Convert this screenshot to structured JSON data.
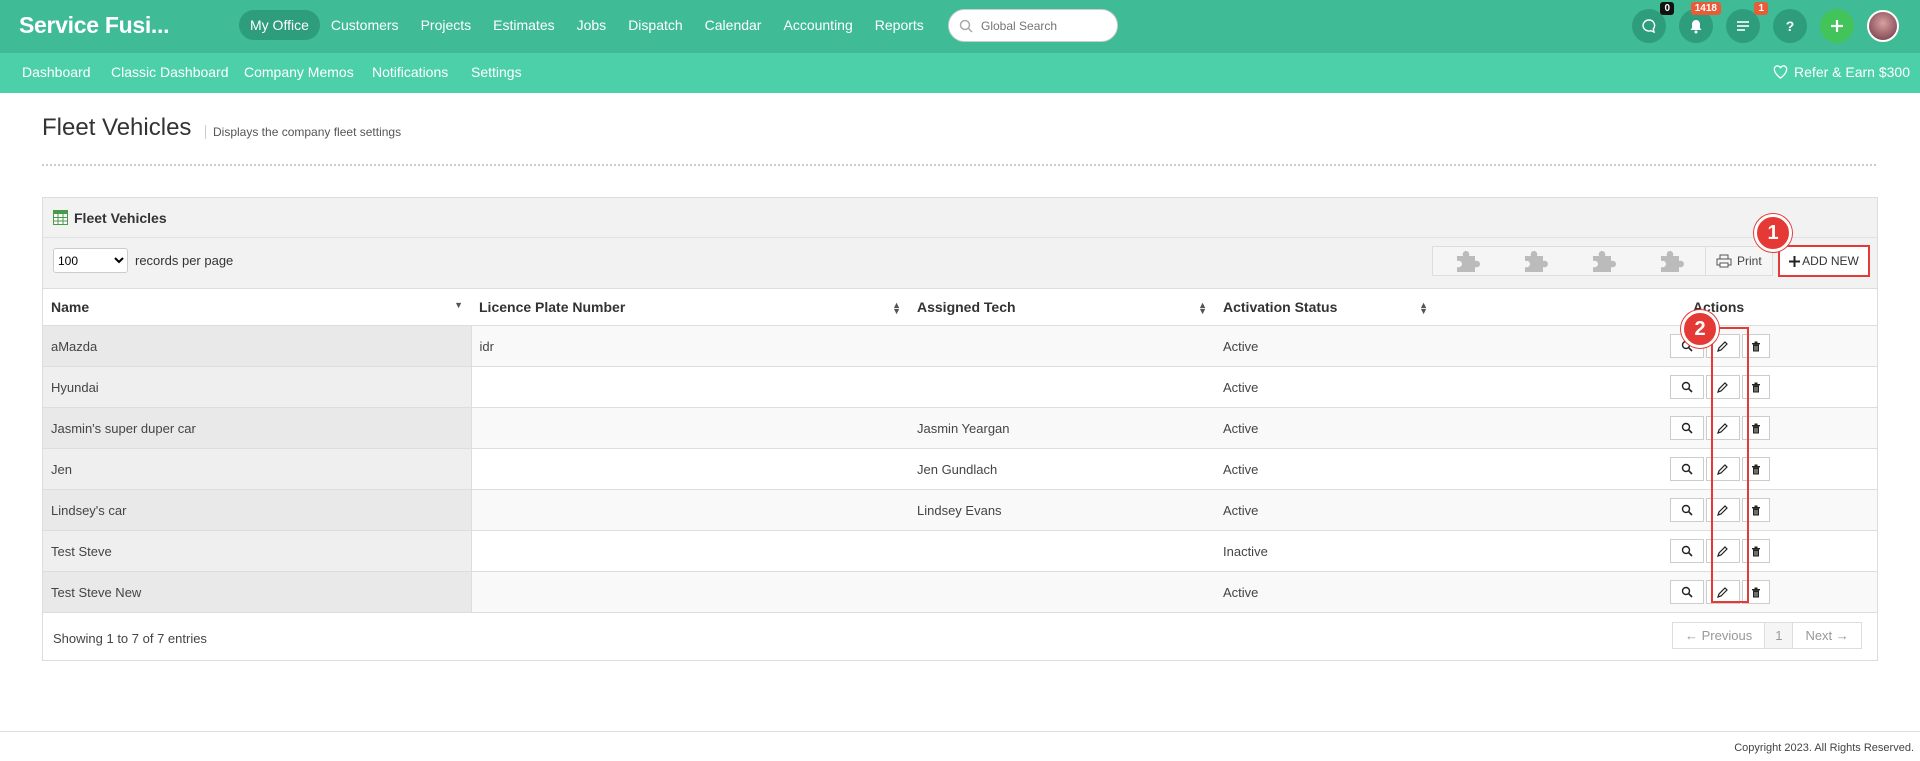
{
  "brand": "Service Fusi...",
  "main_nav": [
    "My Office",
    "Customers",
    "Projects",
    "Estimates",
    "Jobs",
    "Dispatch",
    "Calendar",
    "Accounting",
    "Reports"
  ],
  "search": {
    "placeholder": "Global Search"
  },
  "badges": {
    "chat": "0",
    "notifications": "1418",
    "tasks": "1"
  },
  "sub_nav": [
    "Dashboard",
    "Classic Dashboard",
    "Company Memos",
    "Notifications",
    "Settings"
  ],
  "refer": "Refer & Earn $300",
  "page": {
    "title": "Fleet Vehicles",
    "subtitle": "Displays the company fleet settings"
  },
  "panel": {
    "title": "Fleet Vehicles",
    "rpp_value": "100",
    "rpp_label": "records per page",
    "print": "Print",
    "add_new": "ADD NEW",
    "markers": [
      "1",
      "2"
    ]
  },
  "table": {
    "headers": [
      "Name",
      "Licence Plate Number",
      "Assigned Tech",
      "Activation Status",
      "Actions"
    ],
    "rows": [
      {
        "name": "aMazda",
        "plate": "idr",
        "tech": "",
        "status": "Active"
      },
      {
        "name": "Hyundai",
        "plate": "",
        "tech": "",
        "status": "Active"
      },
      {
        "name": "Jasmin's super duper car",
        "plate": "",
        "tech": "Jasmin Yeargan",
        "status": "Active"
      },
      {
        "name": "Jen",
        "plate": "",
        "tech": "Jen Gundlach",
        "status": "Active"
      },
      {
        "name": "Lindsey's car",
        "plate": "",
        "tech": "Lindsey Evans",
        "status": "Active"
      },
      {
        "name": "Test Steve",
        "plate": "",
        "tech": "",
        "status": "Inactive"
      },
      {
        "name": "Test Steve New",
        "plate": "",
        "tech": "",
        "status": "Active"
      }
    ]
  },
  "footer_info": "Showing 1 to 7 of 7 entries",
  "pager": {
    "prev": "← Previous",
    "page": "1",
    "next": "Next →"
  },
  "copyright": "Copyright 2023. All Rights Reserved."
}
